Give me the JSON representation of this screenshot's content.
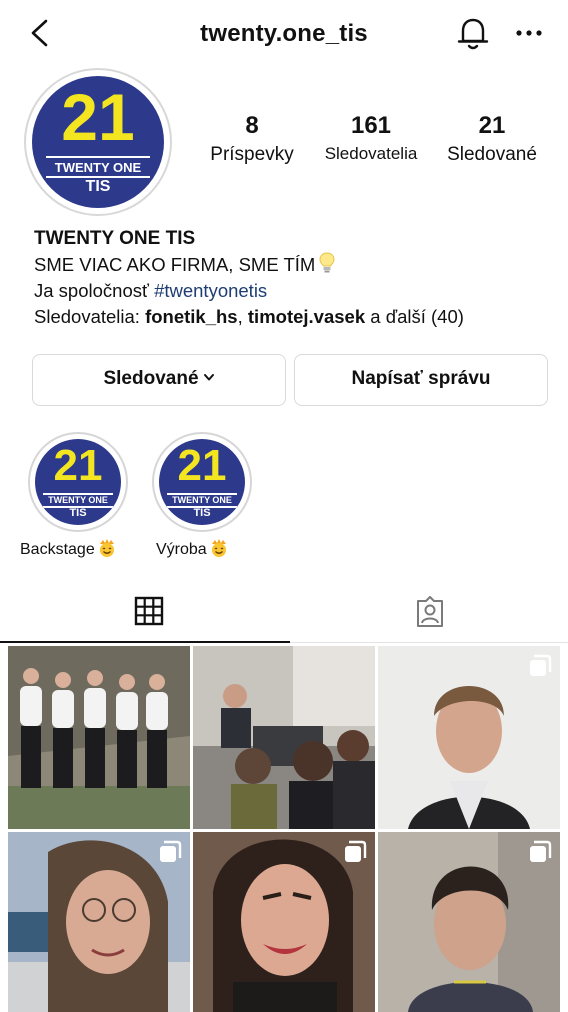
{
  "header": {
    "username": "twenty.one_tis",
    "back_icon": "chevron-left-icon",
    "bell_icon": "bell-icon",
    "more_icon": "more-horizontal-icon"
  },
  "profile": {
    "avatar_logo": {
      "number": "21",
      "line1": "TWENTY ONE",
      "line2": "TIS"
    },
    "stats": [
      {
        "value": "8",
        "label": "Príspevky"
      },
      {
        "value": "161",
        "label": "Sledovatelia"
      },
      {
        "value": "21",
        "label": "Sledované"
      }
    ]
  },
  "bio": {
    "name": "TWENTY ONE TIS",
    "line1": "SME VIAC AKO FIRMA, SME TÍM",
    "line1_icon": "light-bulb-icon",
    "line2_prefix": "Ja spoločnosť ",
    "line2_hashtag": "#twentyonetis",
    "followers_prefix": "Sledovatelia: ",
    "follower1": "fonetik_hs",
    "separator": ", ",
    "follower2": "timotej.vasek",
    "followers_suffix_pre": " a ďalší ",
    "followers_count": "(40)"
  },
  "buttons": {
    "following_label": "Sledované",
    "message_label": "Napísať správu"
  },
  "highlights": [
    {
      "label": "Backstage",
      "emoji": "smiling-face-with-crown-emoji",
      "logo": {
        "number": "21",
        "line1": "TWENTY ONE",
        "line2": "TIS"
      }
    },
    {
      "label": "Výroba",
      "emoji": "smiling-face-with-crown-emoji",
      "logo": {
        "number": "21",
        "line1": "TWENTY ONE",
        "line2": "TIS"
      }
    }
  ],
  "tabs": [
    {
      "name": "grid-tab",
      "icon": "grid-icon",
      "active": true
    },
    {
      "name": "tagged-tab",
      "icon": "tagged-person-icon",
      "active": false
    }
  ],
  "posts": [
    {
      "description_icon": "photo",
      "multi": false,
      "colors": [
        "#8f8a7e",
        "#5d6b55",
        "#e9e9ea"
      ]
    },
    {
      "description_icon": "photo",
      "multi": false,
      "colors": [
        "#c9c6c0",
        "#3b3b3e",
        "#6e5545"
      ]
    },
    {
      "description_icon": "photo",
      "multi": true,
      "colors": [
        "#ebebea",
        "#2a2a2b",
        "#c9a089"
      ]
    },
    {
      "description_icon": "photo",
      "multi": true,
      "colors": [
        "#a7b7c9",
        "#5b4a3e",
        "#d7a891"
      ]
    },
    {
      "description_icon": "photo",
      "multi": true,
      "colors": [
        "#6f5a4c",
        "#d8a58e",
        "#2c1f1b"
      ]
    },
    {
      "description_icon": "photo",
      "multi": true,
      "colors": [
        "#b9b3ab",
        "#3a3c4a",
        "#caa28c"
      ]
    }
  ],
  "colors": {
    "logo_blue": "#2d3a8c",
    "logo_yellow": "#f3e520",
    "hashtag": "#1e3d73"
  }
}
